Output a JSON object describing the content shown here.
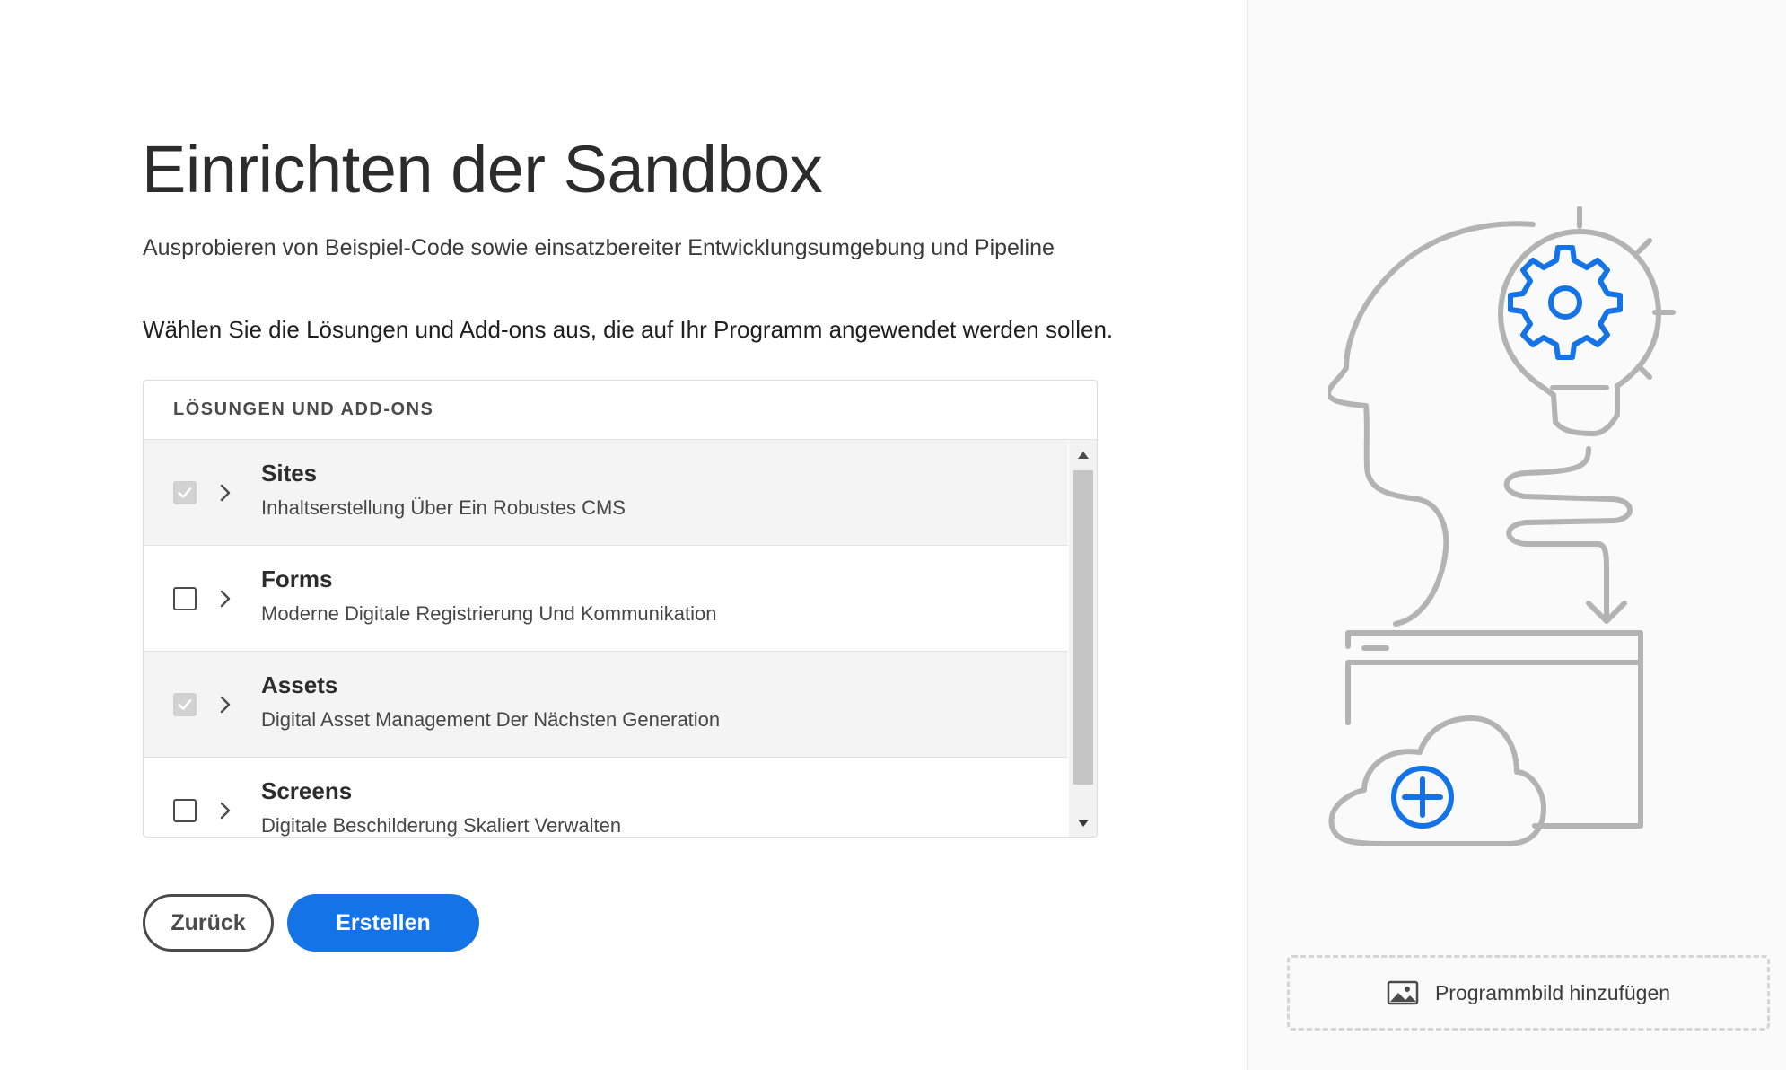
{
  "page": {
    "title": "Einrichten der Sandbox",
    "subtitle": "Ausprobieren von Beispiel-Code sowie einsatzbereiter Entwicklungsumgebung und Pipeline",
    "instruction": "Wählen Sie die Lösungen und Add-ons aus, die auf Ihr Programm angewendet werden sollen."
  },
  "panel": {
    "header": "LÖSUNGEN UND ADD-ONS",
    "items": [
      {
        "title": "Sites",
        "description": "Inhaltserstellung Über Ein Robustes CMS",
        "checked": true,
        "disabled": true
      },
      {
        "title": "Forms",
        "description": "Moderne Digitale Registrierung Und Kommunikation",
        "checked": false,
        "disabled": false
      },
      {
        "title": "Assets",
        "description": "Digital Asset Management Der Nächsten Generation",
        "checked": true,
        "disabled": true
      },
      {
        "title": "Screens",
        "description": "Digitale Beschilderung Skaliert Verwalten",
        "checked": false,
        "disabled": false
      }
    ]
  },
  "actions": {
    "back_label": "Zurück",
    "create_label": "Erstellen"
  },
  "sidebar": {
    "add_image_label": "Programmbild hinzufügen",
    "illustration_icon": "head-lightbulb-gear-cloud-illustration",
    "image_icon": "image-icon"
  },
  "colors": {
    "accent": "#1473e6",
    "illustration_gray": "#b3b3b3"
  }
}
